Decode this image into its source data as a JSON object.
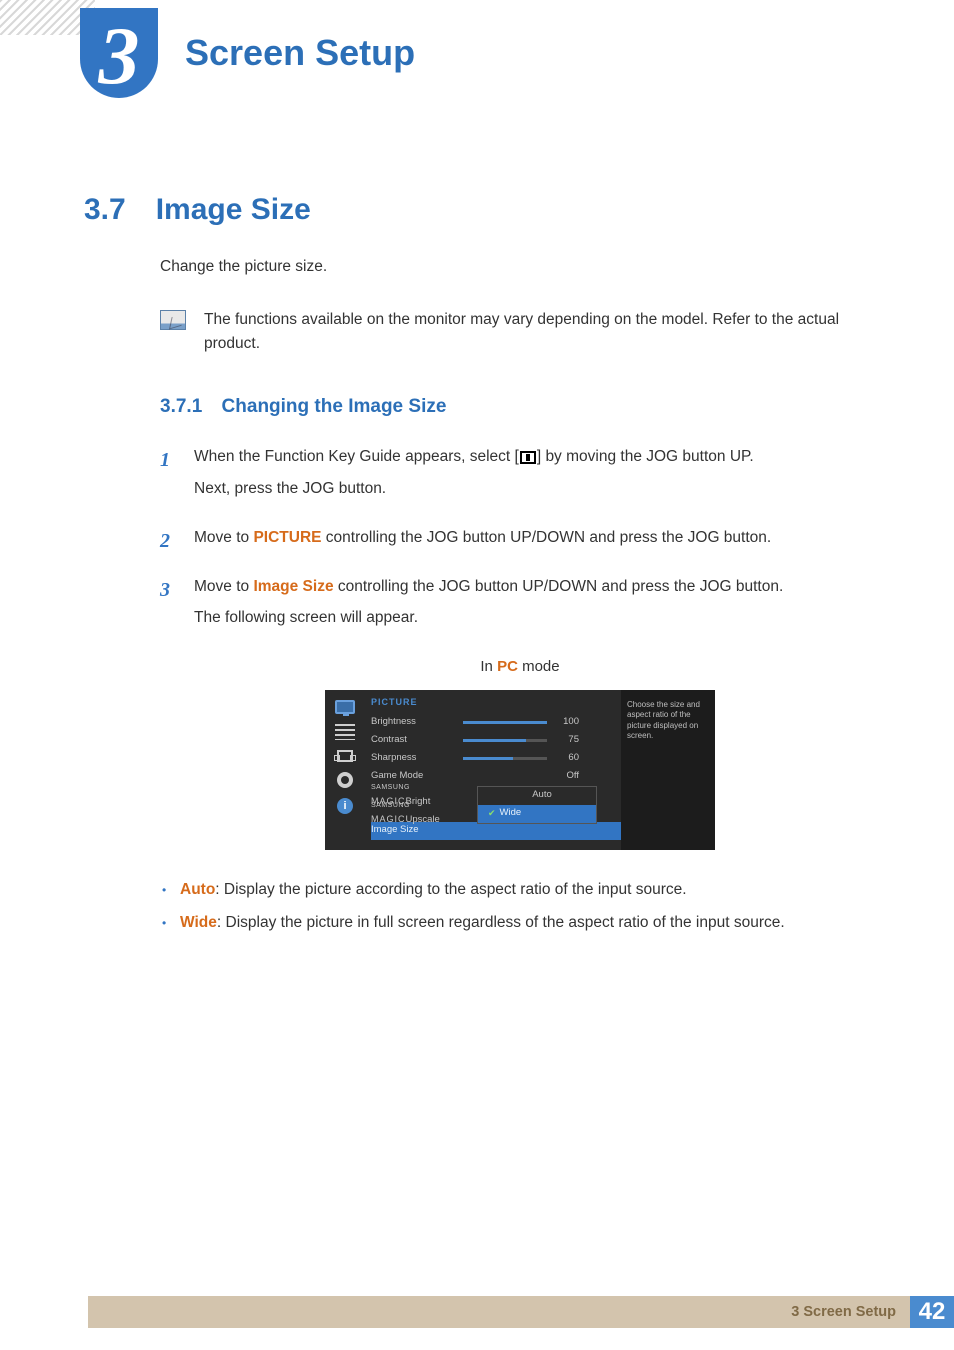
{
  "header": {
    "chapter_number": "3",
    "chapter_title": "Screen Setup"
  },
  "section": {
    "number": "3.7",
    "title": "Image Size",
    "intro": "Change the picture size.",
    "note": "The functions available on the monitor may vary depending on the model. Refer to the actual product."
  },
  "subsection": {
    "number": "3.7.1",
    "title": "Changing the Image Size"
  },
  "steps": [
    {
      "num": "1",
      "line1_pre": "When the Function Key Guide appears, select [",
      "line1_post": "] by moving the JOG button UP.",
      "line2": "Next, press the JOG button."
    },
    {
      "num": "2",
      "pre": "Move to ",
      "hl": "PICTURE",
      "post": " controlling the JOG button UP/DOWN and press the JOG button."
    },
    {
      "num": "3",
      "pre": "Move to ",
      "hl": "Image Size",
      "post": " controlling the JOG button UP/DOWN and press the JOG button.",
      "line2": "The following screen will appear."
    }
  ],
  "mode_caption": {
    "pre": "In ",
    "hl": "PC",
    "post": " mode"
  },
  "osd": {
    "header": "PICTURE",
    "rows": [
      {
        "label": "Brightness",
        "value": "100",
        "fill": 100
      },
      {
        "label": "Contrast",
        "value": "75",
        "fill": 75
      },
      {
        "label": "Sharpness",
        "value": "60",
        "fill": 60
      },
      {
        "label": "Game Mode",
        "value": "Off"
      }
    ],
    "magic_rows": [
      {
        "brand": "SAMSUNG",
        "magic": "MAGIC",
        "suffix": "Bright"
      },
      {
        "brand": "SAMSUNG",
        "magic": "MAGIC",
        "suffix": "Upscale"
      }
    ],
    "highlight_label": "Image Size",
    "submenu": {
      "opt1": "Auto",
      "opt2": "Wide"
    },
    "help": "Choose the size and aspect ratio of the picture displayed on screen.",
    "info_icon": "i"
  },
  "bullets": [
    {
      "hl": "Auto",
      "text": ": Display the picture according to the aspect ratio of the input source."
    },
    {
      "hl": "Wide",
      "text": ": Display the picture in full screen regardless of the aspect ratio of the input source."
    }
  ],
  "footer": {
    "chapter": "3 Screen Setup",
    "page": "42"
  }
}
